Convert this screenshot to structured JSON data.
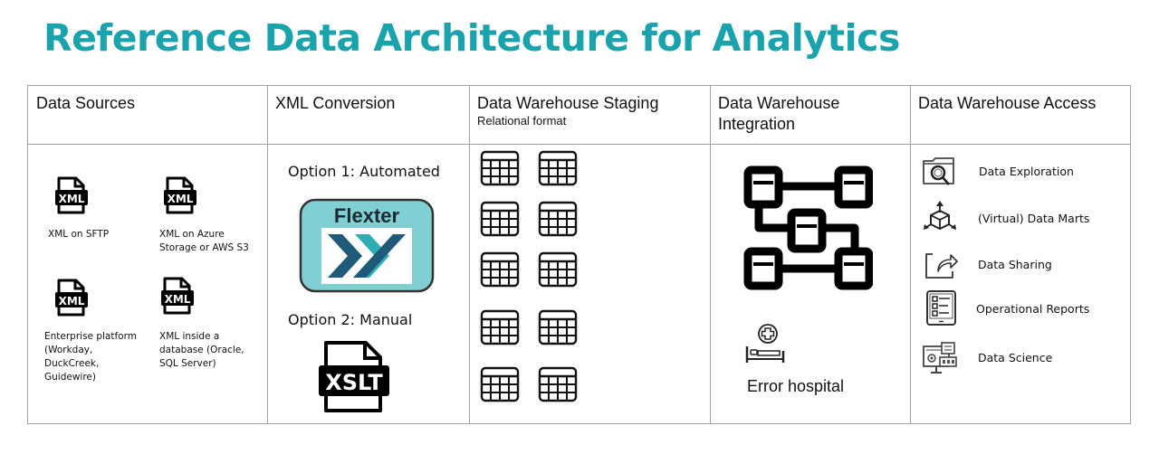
{
  "title": "Reference Data Architecture for Analytics",
  "colors": {
    "title": "#1aa3ad",
    "flexter_bg": "#7fcfd3",
    "flexter_dark": "#1f5a78",
    "flexter_teal": "#1aa3ad",
    "border": "#a0a0a0"
  },
  "columns": [
    {
      "header": "Data Sources"
    },
    {
      "header": "XML Conversion"
    },
    {
      "header": "Data Warehouse Staging",
      "subheader": "Relational format"
    },
    {
      "header": "Data Warehouse Integration"
    },
    {
      "header": "Data Warehouse Access"
    }
  ],
  "sources": [
    {
      "icon": "xml-file-icon",
      "badge": "XML",
      "label": "XML on SFTP"
    },
    {
      "icon": "xml-file-icon",
      "badge": "XML",
      "label": "XML on Azure Storage or AWS S3"
    },
    {
      "icon": "xml-file-icon",
      "badge": "XML",
      "label": "Enterprise platform (Workday, DuckCreek, Guidewire)"
    },
    {
      "icon": "xml-file-icon",
      "badge": "XML",
      "label": "XML inside a database (Oracle, SQL Server)"
    }
  ],
  "conversion": {
    "option1": "Option 1: Automated",
    "flexter_label": "Flexter",
    "option2": "Option 2: Manual",
    "xslt_badge": "XSLT"
  },
  "staging": {
    "table_icon_count": 10,
    "icon": "table-icon"
  },
  "integration": {
    "icon": "data-model-icon",
    "error_label": "Error hospital",
    "error_icon": "hospital-bed-icon"
  },
  "access": [
    {
      "icon": "folder-search-icon",
      "label": "Data Exploration"
    },
    {
      "icon": "cube-arrows-icon",
      "label": "(Virtual) Data Marts"
    },
    {
      "icon": "share-icon",
      "label": "Data Sharing"
    },
    {
      "icon": "report-checklist-icon",
      "label": "Operational Reports"
    },
    {
      "icon": "data-science-dashboard-icon",
      "label": "Data Science"
    }
  ]
}
